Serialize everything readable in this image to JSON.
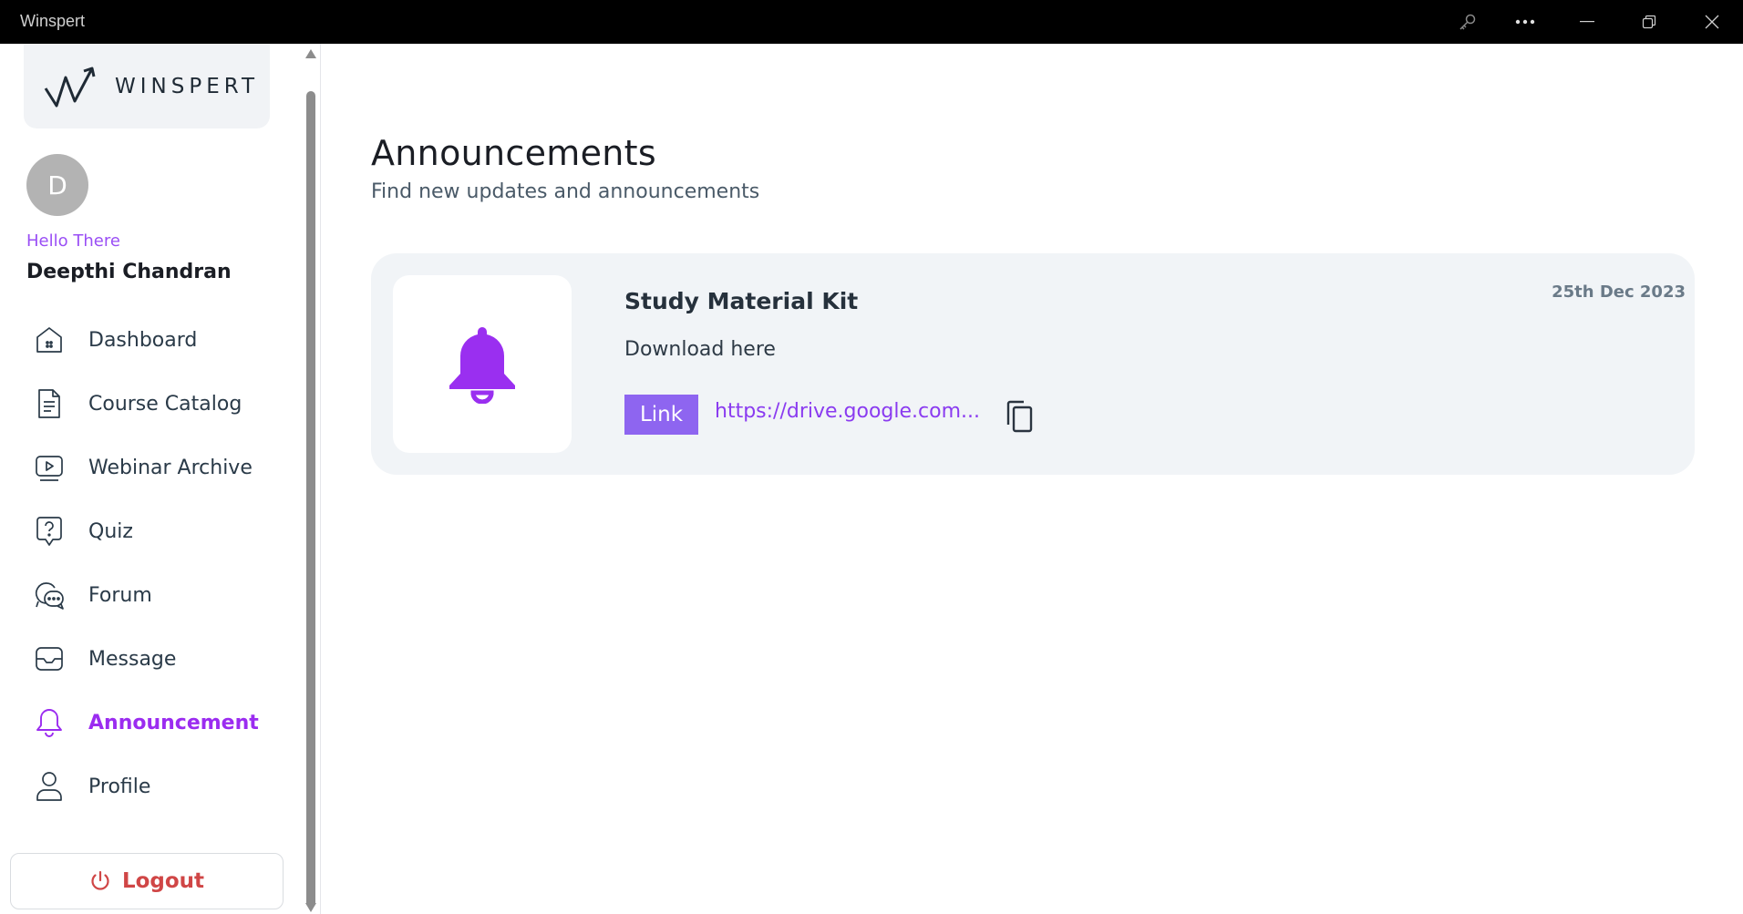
{
  "window": {
    "title": "Winspert",
    "controls": [
      "key-icon",
      "more-icon",
      "minimize-icon",
      "restore-icon",
      "close-icon"
    ]
  },
  "sidebar": {
    "logo_text": "WINSPERT",
    "avatar_initial": "D",
    "greeting": "Hello There",
    "user_name": "Deepthi Chandran",
    "items": [
      {
        "label": "Dashboard",
        "icon": "home-icon",
        "active": false
      },
      {
        "label": "Course Catalog",
        "icon": "document-icon",
        "active": false
      },
      {
        "label": "Webinar Archive",
        "icon": "video-play-icon",
        "active": false
      },
      {
        "label": "Quiz",
        "icon": "question-icon",
        "active": false
      },
      {
        "label": "Forum",
        "icon": "chat-bubbles-icon",
        "active": false
      },
      {
        "label": "Message",
        "icon": "envelope-icon",
        "active": false
      },
      {
        "label": "Announcement",
        "icon": "bell-icon",
        "active": true
      },
      {
        "label": "Profile",
        "icon": "user-icon",
        "active": false
      }
    ],
    "logout_label": "Logout"
  },
  "main": {
    "title": "Announcements",
    "subtitle": "Find new updates and announcements",
    "announcements": [
      {
        "title": "Study Material Kit",
        "date": "25th Dec 2023",
        "description": "Download here",
        "link_label": "Link",
        "link_url": "https://drive.google.com..."
      }
    ]
  },
  "colors": {
    "accent": "#9b2cf0",
    "bell": "#9a2ff0",
    "link_badge": "#8e65f0",
    "logout": "#d04646",
    "card_bg": "#f1f4f7"
  }
}
